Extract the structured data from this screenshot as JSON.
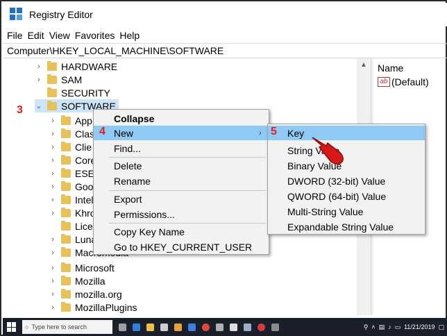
{
  "window": {
    "title": "Registry Editor"
  },
  "menu": [
    "File",
    "Edit",
    "View",
    "Favorites",
    "Help"
  ],
  "address": "Computer\\HKEY_LOCAL_MACHINE\\SOFTWARE",
  "tree": [
    {
      "label": "HARDWARE",
      "expander": "›"
    },
    {
      "label": "SAM",
      "expander": "›"
    },
    {
      "label": "SECURITY",
      "expander": ""
    },
    {
      "label": "SOFTWARE",
      "expander": "⌄"
    },
    {
      "label": "App",
      "expander": "›"
    },
    {
      "label": "Clas",
      "expander": "›"
    },
    {
      "label": "Clie",
      "expander": "›"
    },
    {
      "label": "Core",
      "expander": "›"
    },
    {
      "label": "ESET",
      "expander": "›"
    },
    {
      "label": "Goo",
      "expander": "›"
    },
    {
      "label": "Intel",
      "expander": "›"
    },
    {
      "label": "Khro",
      "expander": "›"
    },
    {
      "label": "Licer",
      "expander": ""
    },
    {
      "label": "Luna",
      "expander": "›"
    },
    {
      "label": "Macromedia",
      "expander": "›"
    },
    {
      "label": "Microsoft",
      "expander": "›"
    },
    {
      "label": "Mozilla",
      "expander": "›"
    },
    {
      "label": "mozilla.org",
      "expander": "›"
    },
    {
      "label": "MozillaPlugins",
      "expander": "›"
    }
  ],
  "values_pane": {
    "column_name": "Name",
    "default_label": "(Default)",
    "icon_text": "ab"
  },
  "context_menu": {
    "collapse": "Collapse",
    "new": "New",
    "find": "Find...",
    "delete": "Delete",
    "rename": "Rename",
    "export": "Export",
    "permissions": "Permissions...",
    "copy_key_name": "Copy Key Name",
    "goto_hkcu": "Go to HKEY_CURRENT_USER"
  },
  "submenu": {
    "key": "Key",
    "string_value": "String Value",
    "binary_value": "Binary Value",
    "dword_value": "DWORD (32-bit) Value",
    "qword_value": "QWORD (64-bit) Value",
    "multi_string_value": "Multi-String Value",
    "expandable_string_value": "Expandable String Value"
  },
  "steps": {
    "s3": "3",
    "s4": "4",
    "s5": "5"
  },
  "taskbar": {
    "search_placeholder": "Type here to search",
    "date": "11/21/2019"
  },
  "colors": {
    "highlight": "#8fcaf5",
    "step_red": "#e02020",
    "taskbar": "#1b1f2a",
    "folder": "#e7c25a"
  }
}
